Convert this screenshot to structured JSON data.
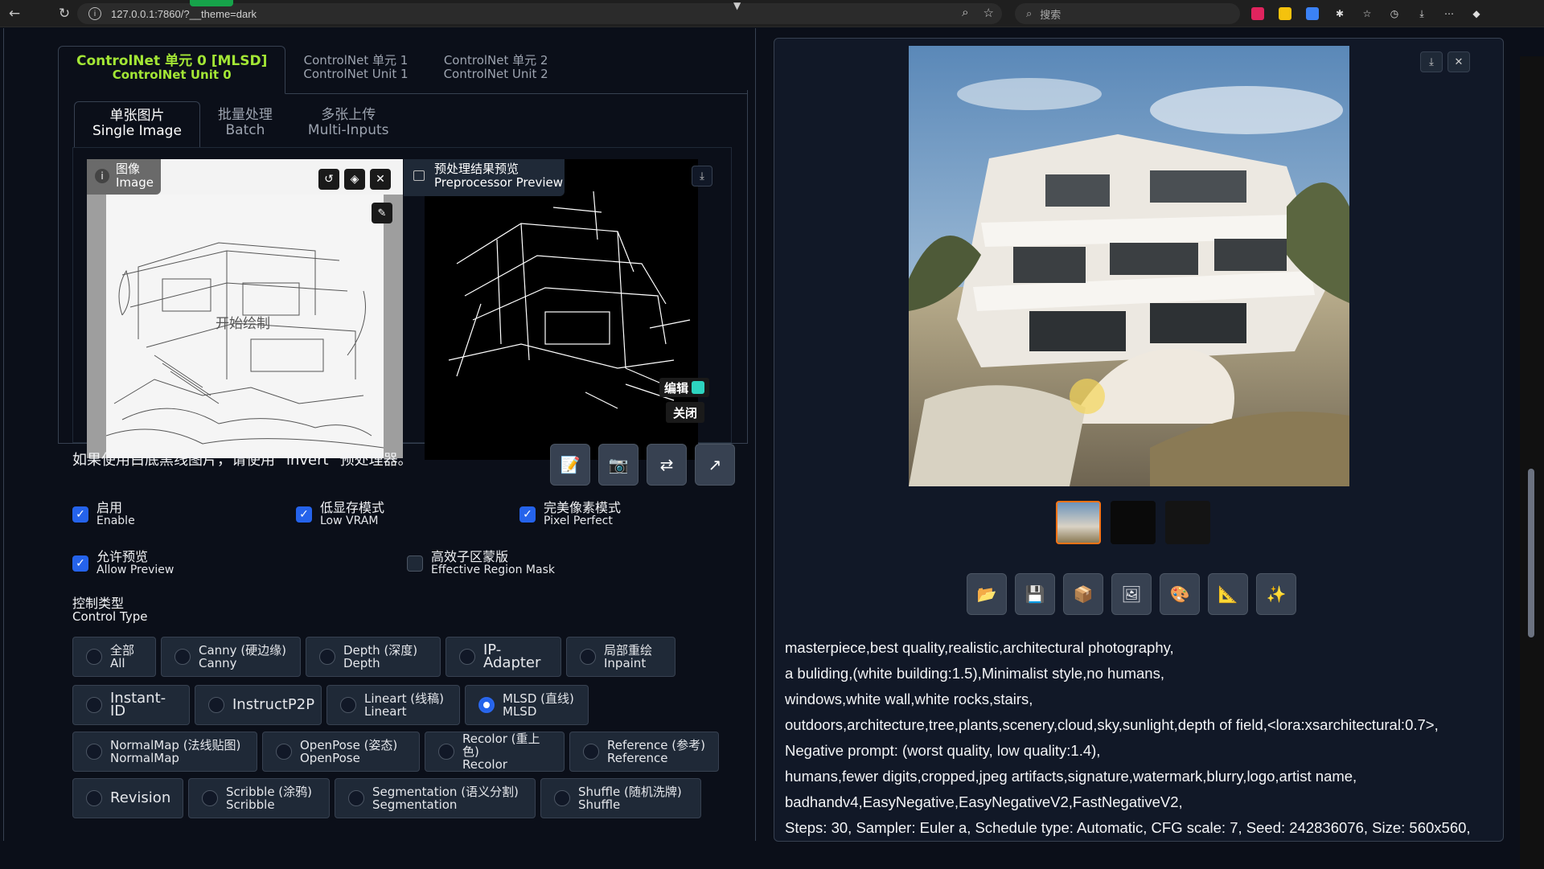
{
  "browser": {
    "url": "127.0.0.1:7860/?__theme=dark",
    "search_placeholder": "搜索"
  },
  "units": [
    {
      "cn": "ControlNet 单元 0 [MLSD]",
      "en": "ControlNet Unit 0"
    },
    {
      "cn": "ControlNet 单元 1",
      "en": "ControlNet Unit 1"
    },
    {
      "cn": "ControlNet 单元 2",
      "en": "ControlNet Unit 2"
    }
  ],
  "sub_tabs": [
    {
      "cn": "单张图片",
      "en": "Single Image"
    },
    {
      "cn": "批量处理",
      "en": "Batch"
    },
    {
      "cn": "多张上传",
      "en": "Multi-Inputs"
    }
  ],
  "image_panel": {
    "cn": "图像",
    "en": "Image",
    "canvas_text": "开始绘制"
  },
  "preprocessor_panel": {
    "cn": "预处理结果预览",
    "en": "Preprocessor Preview",
    "edit": "编辑",
    "close": "关闭"
  },
  "hint": "如果使用白底黑线图片，请使用 \"invert\" 预处理器。",
  "checks": {
    "enable": {
      "cn": "启用",
      "en": "Enable",
      "checked": true
    },
    "lowvram": {
      "cn": "低显存模式",
      "en": "Low VRAM",
      "checked": true
    },
    "pixel": {
      "cn": "完美像素模式",
      "en": "Pixel Perfect",
      "checked": true
    },
    "preview": {
      "cn": "允许预览",
      "en": "Allow Preview",
      "checked": true
    },
    "mask": {
      "cn": "高效子区蒙版",
      "en": "Effective Region Mask",
      "checked": false
    }
  },
  "control_type": {
    "cn": "控制类型",
    "en": "Control Type"
  },
  "radios": {
    "row1": [
      {
        "cn": "全部",
        "en": "All"
      },
      {
        "cn": "Canny (硬边缘)",
        "en": "Canny"
      },
      {
        "cn": "Depth (深度)",
        "en": "Depth"
      },
      {
        "single": "IP-Adapter"
      },
      {
        "cn": "局部重绘",
        "en": "Inpaint"
      }
    ],
    "row2": [
      {
        "single": "Instant-ID"
      },
      {
        "single": "InstructP2P"
      },
      {
        "cn": "Lineart (线稿)",
        "en": "Lineart"
      },
      {
        "cn": "MLSD (直线)",
        "en": "MLSD",
        "selected": true
      }
    ],
    "row3": [
      {
        "cn": "NormalMap (法线贴图)",
        "en": "NormalMap"
      },
      {
        "cn": "OpenPose (姿态)",
        "en": "OpenPose"
      },
      {
        "cn": "Recolor (重上色)",
        "en": "Recolor"
      },
      {
        "cn": "Reference (参考)",
        "en": "Reference"
      }
    ],
    "row4": [
      {
        "single": "Revision"
      },
      {
        "cn": "Scribble (涂鸦)",
        "en": "Scribble"
      },
      {
        "cn": "Segmentation (语义分割)",
        "en": "Segmentation"
      },
      {
        "cn": "Shuffle (随机洗牌)",
        "en": "Shuffle"
      }
    ]
  },
  "generation_info": [
    "masterpiece,best quality,realistic,architectural photography,",
    "a buliding,(white building:1.5),Minimalist style,no humans,",
    "windows,white wall,white rocks,stairs,",
    "outdoors,architecture,tree,plants,scenery,cloud,sky,sunlight,depth of field,<lora:xsarchitectural:0.7>,",
    "Negative prompt: (worst quality, low quality:1.4),",
    "humans,fewer digits,cropped,jpeg artifacts,signature,watermark,blurry,logo,artist name,",
    "badhandv4,EasyNegative,EasyNegativeV2,FastNegativeV2,",
    "Steps: 30, Sampler: Euler a, Schedule type: Automatic, CFG scale: 7, Seed: 242836076, Size: 560x560,"
  ],
  "colors": {
    "accent": "#a3e635",
    "checkbox": "#2563eb",
    "background": "#0b0f19"
  }
}
